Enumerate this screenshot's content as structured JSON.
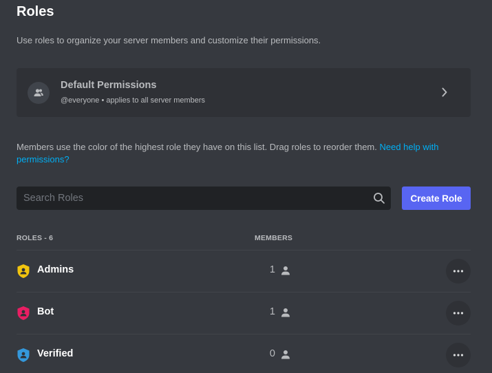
{
  "header": {
    "title": "Roles",
    "subtitle": "Use roles to organize your server members and customize their permissions."
  },
  "default_permissions": {
    "title": "Default Permissions",
    "subtitle": "@everyone • applies to all server members",
    "icon": "members-icon",
    "chevron_icon": "chevron-right-icon"
  },
  "help": {
    "text": "Members use the color of the highest role they have on this list. Drag roles to reorder them. ",
    "link": "Need help with permissions?"
  },
  "search": {
    "placeholder": "Search Roles",
    "value": "",
    "icon": "search-icon"
  },
  "create_role_label": "Create Role",
  "table": {
    "roles_header": "ROLES - 6",
    "members_header": "MEMBERS"
  },
  "roles": [
    {
      "name": "Admins",
      "members": "1",
      "color": "#f1c40f",
      "icon": "shield-icon"
    },
    {
      "name": "Bot",
      "members": "1",
      "color": "#e91e63",
      "icon": "shield-icon"
    },
    {
      "name": "Verified",
      "members": "0",
      "color": "#3498db",
      "icon": "shield-icon"
    }
  ],
  "colors": {
    "accent": "#5865f2",
    "link": "#00aff4",
    "background": "#36393f"
  }
}
